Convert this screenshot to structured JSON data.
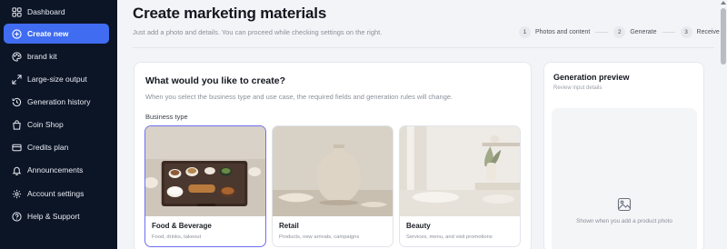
{
  "sidebar": {
    "items": [
      {
        "label": "Dashboard",
        "icon": "grid-icon"
      },
      {
        "label": "Create new",
        "icon": "plus-circle-icon",
        "active": true
      },
      {
        "label": "brand kit",
        "icon": "palette-icon"
      },
      {
        "label": "Large-size output",
        "icon": "expand-icon"
      },
      {
        "label": "Generation history",
        "icon": "history-icon"
      },
      {
        "label": "Coin Shop",
        "icon": "shopping-bag-icon"
      },
      {
        "label": "Credits plan",
        "icon": "credit-card-icon"
      },
      {
        "label": "Announcements",
        "icon": "bell-icon"
      },
      {
        "label": "Account settings",
        "icon": "gear-icon"
      },
      {
        "label": "Help & Support",
        "icon": "help-circle-icon"
      }
    ]
  },
  "header": {
    "title": "Create marketing materials",
    "subtitle": "Just add a photo and details. You can proceed while checking settings on the right."
  },
  "steps": [
    {
      "num": "1",
      "label": "Photos and content"
    },
    {
      "num": "2",
      "label": "Generate"
    },
    {
      "num": "3",
      "label": "Receive"
    }
  ],
  "create_card": {
    "title": "What would you like to create?",
    "description": "When you select the business type and use case, the required fields and generation rules will change.",
    "business_type_label": "Business type",
    "options": [
      {
        "title": "Food & Beverage",
        "desc": "Food, drinks, takeout",
        "selected": true
      },
      {
        "title": "Retail",
        "desc": "Products, new arrivals, campaigns",
        "selected": false
      },
      {
        "title": "Beauty",
        "desc": "Services, menu, and visit promotions",
        "selected": false
      }
    ]
  },
  "preview": {
    "title": "Generation preview",
    "subtitle": "Review input details",
    "empty_note": "Shown when you add a product photo",
    "icon": "image-icon"
  },
  "colors": {
    "sidebar_bg": "#0c1526",
    "accent": "#3f6cf0",
    "selected_border": "#6d6ff0"
  }
}
